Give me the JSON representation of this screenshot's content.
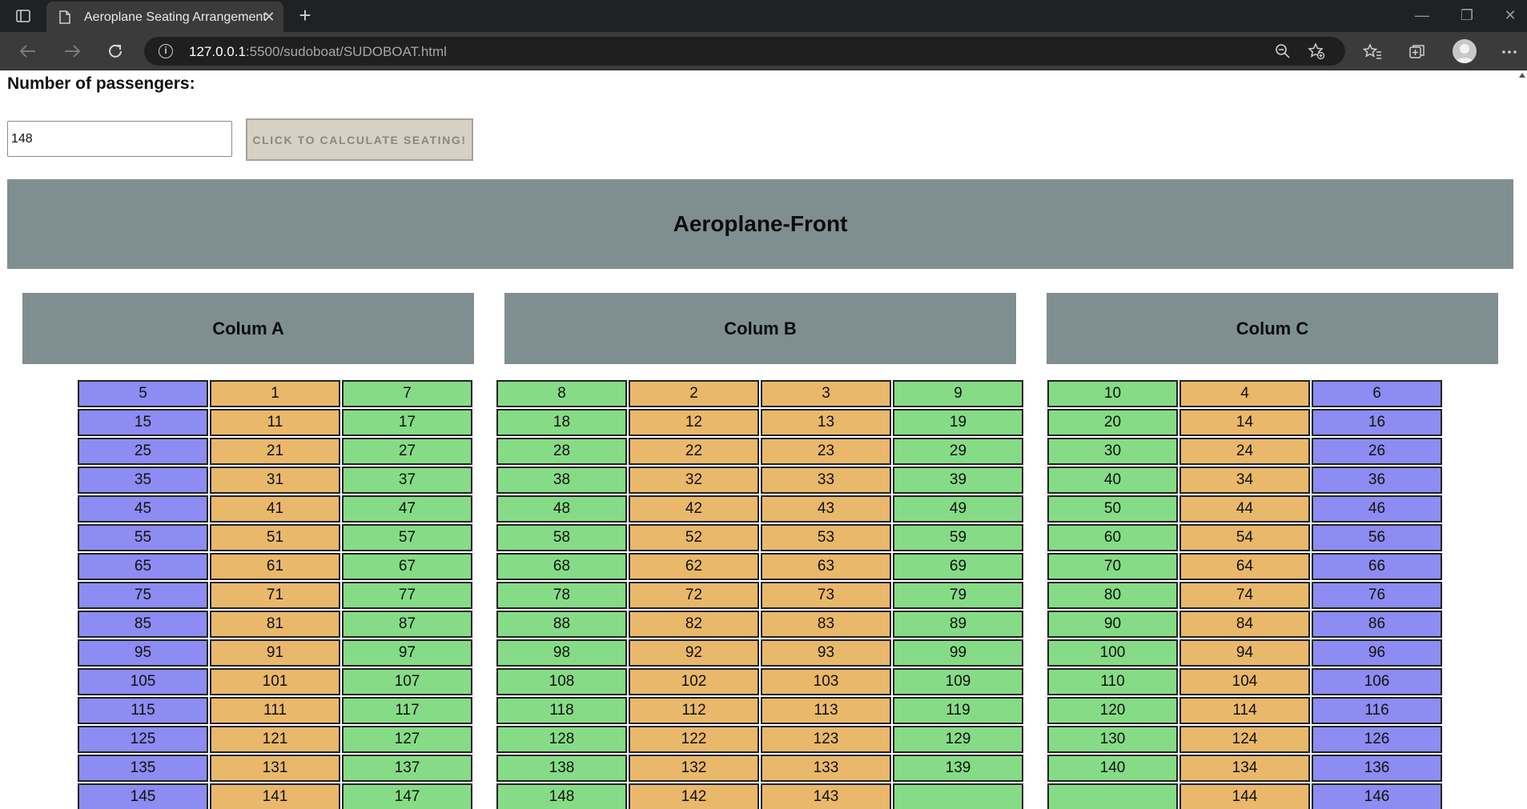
{
  "browser": {
    "tab_title": "Aeroplane Seating Arrangement",
    "url_host": "127.0.0.1",
    "url_rest": ":5500/sudoboat/SUDOBOAT.html"
  },
  "page": {
    "passengers_label": "Number of passengers:",
    "passengers_value": "148",
    "calculate_button": "CLICK TO CALCULATE SEATING!",
    "front_title": "Aeroplane-Front"
  },
  "colors": {
    "aisle": "#e9b86a",
    "window": "#8c8cf2",
    "middle": "#86dc86",
    "header": "#7f8f91"
  },
  "columns": [
    {
      "header": "Colum A",
      "seat_types": [
        "window",
        "aisle",
        "middle"
      ],
      "rows": [
        [
          "5",
          "1",
          "7"
        ],
        [
          "15",
          "11",
          "17"
        ],
        [
          "25",
          "21",
          "27"
        ],
        [
          "35",
          "31",
          "37"
        ],
        [
          "45",
          "41",
          "47"
        ],
        [
          "55",
          "51",
          "57"
        ],
        [
          "65",
          "61",
          "67"
        ],
        [
          "75",
          "71",
          "77"
        ],
        [
          "85",
          "81",
          "87"
        ],
        [
          "95",
          "91",
          "97"
        ],
        [
          "105",
          "101",
          "107"
        ],
        [
          "115",
          "111",
          "117"
        ],
        [
          "125",
          "121",
          "127"
        ],
        [
          "135",
          "131",
          "137"
        ],
        [
          "145",
          "141",
          "147"
        ]
      ]
    },
    {
      "header": "Colum B",
      "seat_types": [
        "middle",
        "aisle",
        "aisle",
        "middle"
      ],
      "rows": [
        [
          "8",
          "2",
          "3",
          "9"
        ],
        [
          "18",
          "12",
          "13",
          "19"
        ],
        [
          "28",
          "22",
          "23",
          "29"
        ],
        [
          "38",
          "32",
          "33",
          "39"
        ],
        [
          "48",
          "42",
          "43",
          "49"
        ],
        [
          "58",
          "52",
          "53",
          "59"
        ],
        [
          "68",
          "62",
          "63",
          "69"
        ],
        [
          "78",
          "72",
          "73",
          "79"
        ],
        [
          "88",
          "82",
          "83",
          "89"
        ],
        [
          "98",
          "92",
          "93",
          "99"
        ],
        [
          "108",
          "102",
          "103",
          "109"
        ],
        [
          "118",
          "112",
          "113",
          "119"
        ],
        [
          "128",
          "122",
          "123",
          "129"
        ],
        [
          "138",
          "132",
          "133",
          "139"
        ],
        [
          "148",
          "142",
          "143",
          ""
        ]
      ]
    },
    {
      "header": "Colum C",
      "seat_types": [
        "middle",
        "aisle",
        "window"
      ],
      "rows": [
        [
          "10",
          "4",
          "6"
        ],
        [
          "20",
          "14",
          "16"
        ],
        [
          "30",
          "24",
          "26"
        ],
        [
          "40",
          "34",
          "36"
        ],
        [
          "50",
          "44",
          "46"
        ],
        [
          "60",
          "54",
          "56"
        ],
        [
          "70",
          "64",
          "66"
        ],
        [
          "80",
          "74",
          "76"
        ],
        [
          "90",
          "84",
          "86"
        ],
        [
          "100",
          "94",
          "96"
        ],
        [
          "110",
          "104",
          "106"
        ],
        [
          "120",
          "114",
          "116"
        ],
        [
          "130",
          "124",
          "126"
        ],
        [
          "140",
          "134",
          "136"
        ],
        [
          "",
          "144",
          "146"
        ]
      ]
    }
  ]
}
